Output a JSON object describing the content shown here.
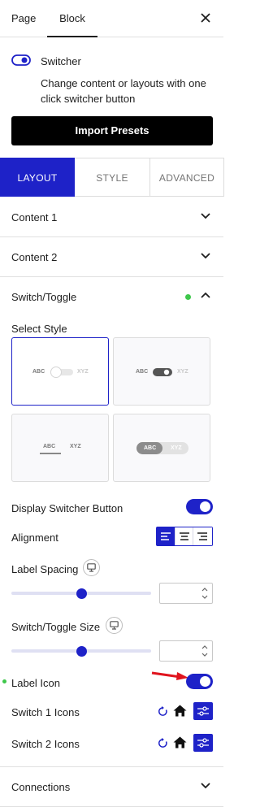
{
  "header": {
    "tab_page": "Page",
    "tab_block": "Block"
  },
  "block": {
    "title": "Switcher",
    "description": "Change content or layouts with one click switcher button",
    "import_label": "Import Presets"
  },
  "layout_tabs": {
    "layout": "LAYOUT",
    "style": "STYLE",
    "advanced": "ADVANCED"
  },
  "panels": {
    "content1": "Content 1",
    "content2": "Content 2",
    "switch_toggle": "Switch/Toggle",
    "connections": "Connections"
  },
  "select_style": {
    "label": "Select Style",
    "card1_left": "ABC",
    "card1_right": "XYZ",
    "card2_left": "ABC",
    "card2_right": "XYZ",
    "card3_left": "ABC",
    "card3_right": "XYZ",
    "card4_left": "ABC",
    "card4_right": "XYZ"
  },
  "settings": {
    "display_switcher": "Display Switcher Button",
    "alignment": "Alignment",
    "label_spacing": "Label Spacing",
    "switch_size": "Switch/Toggle Size",
    "label_icon": "Label Icon",
    "switch1_icons": "Switch 1 Icons",
    "switch2_icons": "Switch 2 Icons"
  },
  "values": {
    "display_switcher_on": true,
    "label_icon_on": true,
    "alignment_selected": "left",
    "label_spacing_slider": 0.5,
    "switch_size_slider": 0.5
  },
  "colors": {
    "accent": "#1e22c8",
    "status_dot": "#3ec74b",
    "arrow": "#e0141e"
  }
}
